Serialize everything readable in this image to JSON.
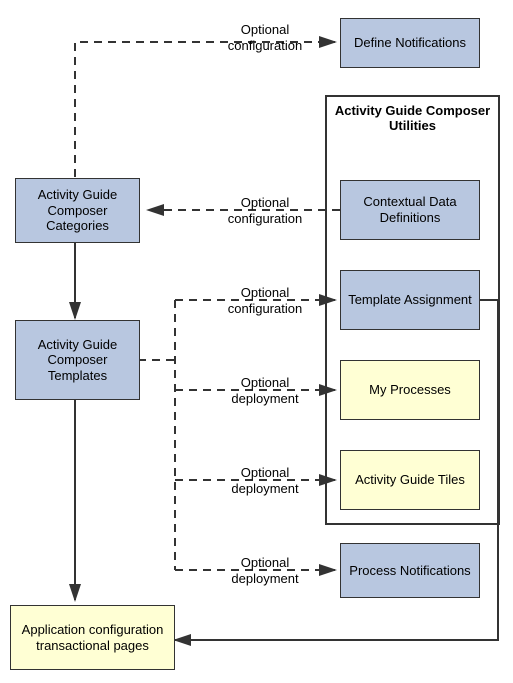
{
  "labels": {
    "optional_config": "Optional configuration",
    "optional_deploy": "Optional deployment"
  },
  "nodes": {
    "define_notifications": "Define Notifications",
    "categories": "Activity Guide Composer Categories",
    "templates": "Activity Guide Composer Templates",
    "app_config": "Application configuration transactional pages",
    "process_notifications": "Process Notifications"
  },
  "group": {
    "title": "Activity Guide Composer Utilities",
    "contextual": "Contextual Data Definitions",
    "template_assignment": "Template Assignment",
    "my_processes": "My Processes",
    "ag_tiles": "Activity Guide Tiles"
  }
}
